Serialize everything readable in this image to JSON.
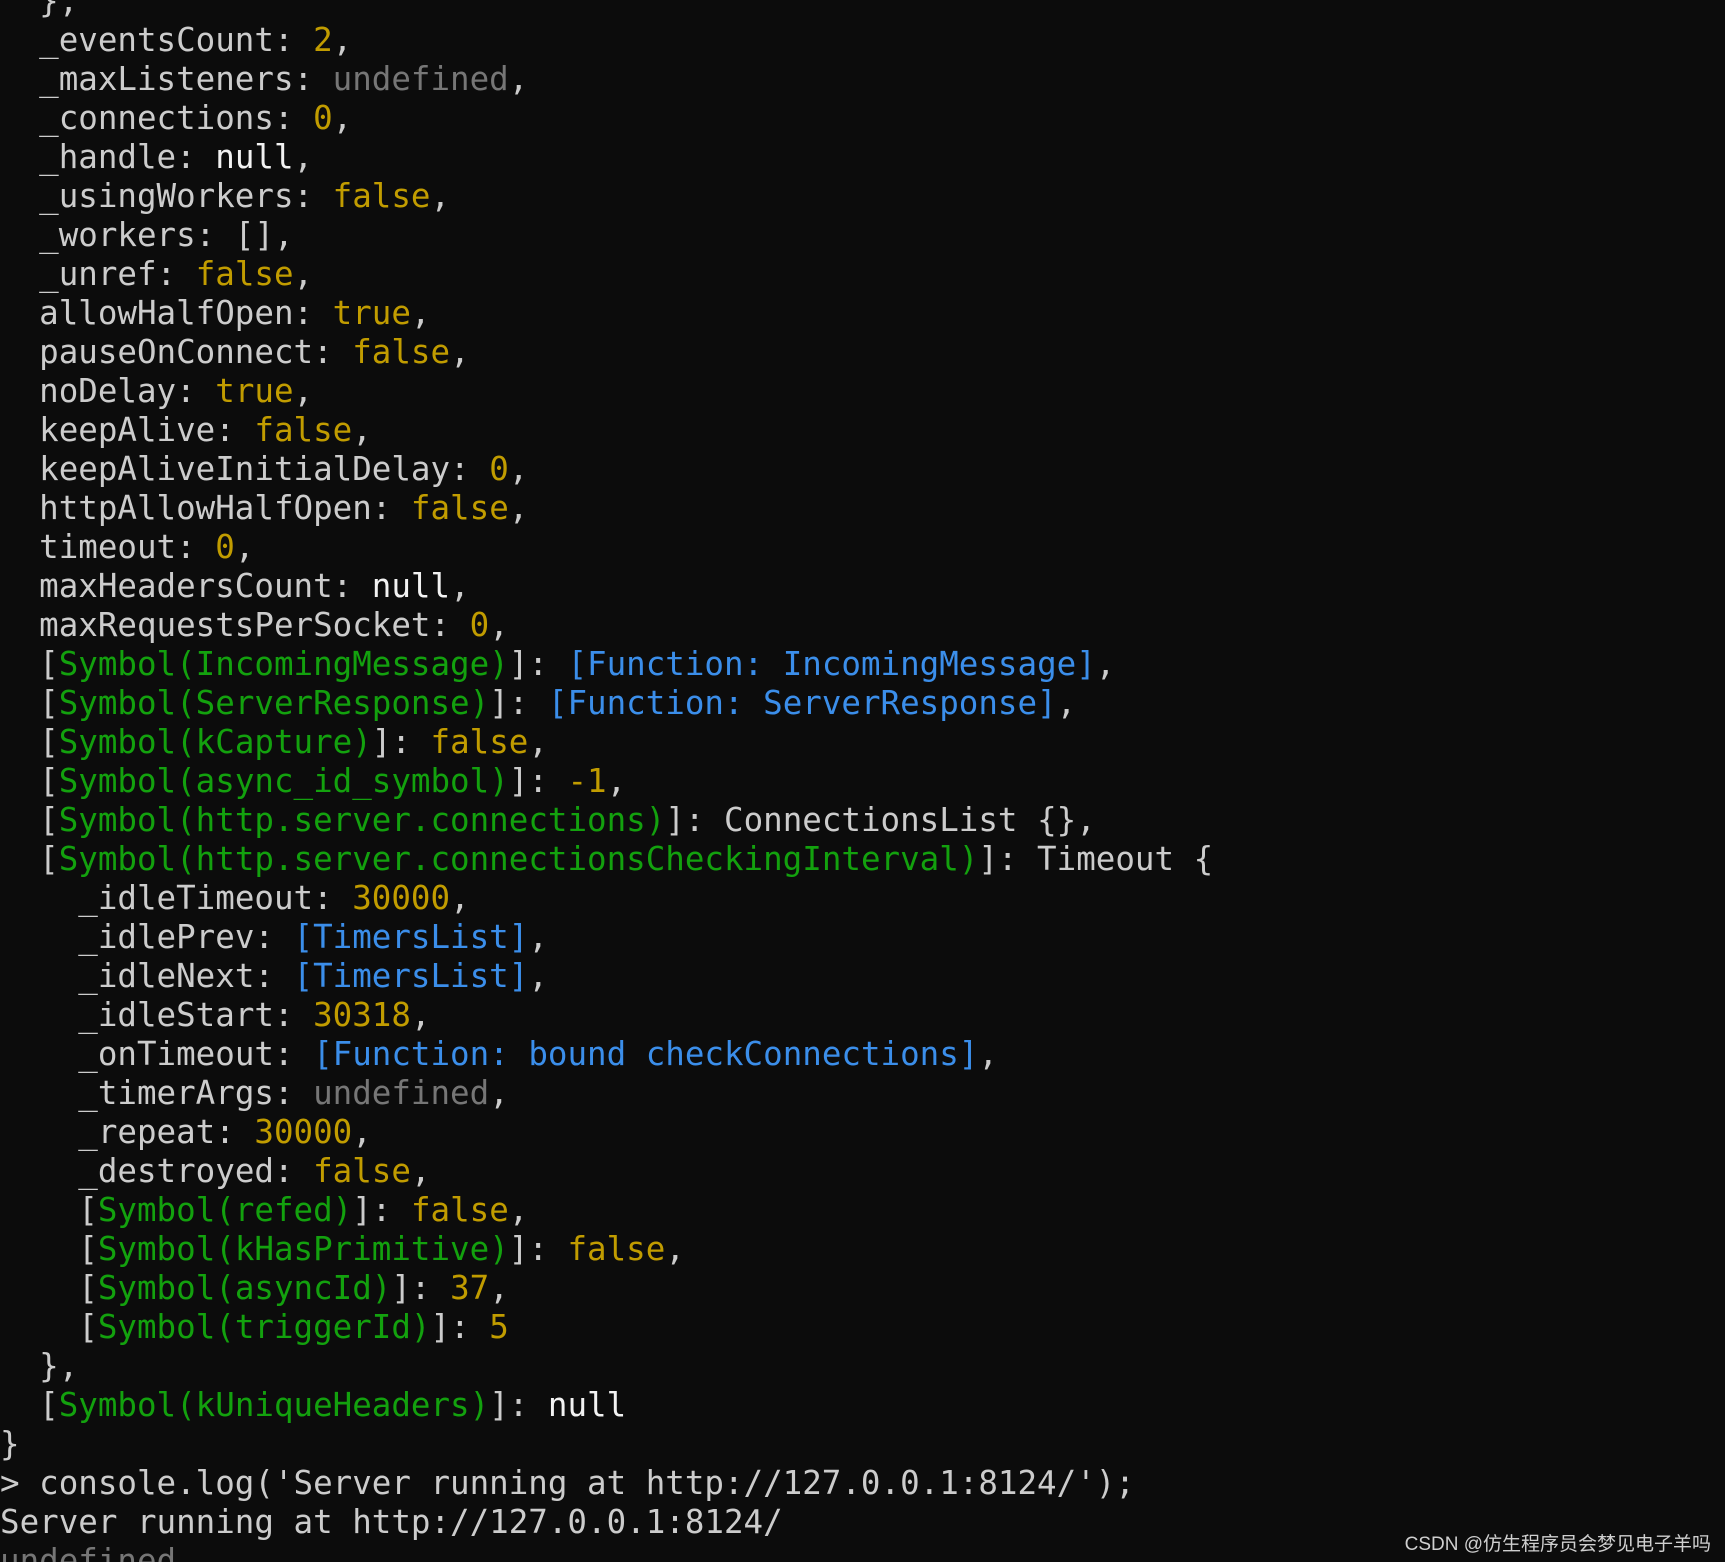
{
  "terminal": {
    "lines": [
      {
        "indent": 1,
        "parts": [
          {
            "t": "},",
            "c": "default"
          }
        ]
      },
      {
        "indent": 1,
        "parts": [
          {
            "t": "_eventsCount: ",
            "c": "default"
          },
          {
            "t": "2",
            "c": "num"
          },
          {
            "t": ",",
            "c": "default"
          }
        ]
      },
      {
        "indent": 1,
        "parts": [
          {
            "t": "_maxListeners: ",
            "c": "default"
          },
          {
            "t": "undefined",
            "c": "undef"
          },
          {
            "t": ",",
            "c": "default"
          }
        ]
      },
      {
        "indent": 1,
        "parts": [
          {
            "t": "_connections: ",
            "c": "default"
          },
          {
            "t": "0",
            "c": "num"
          },
          {
            "t": ",",
            "c": "default"
          }
        ]
      },
      {
        "indent": 1,
        "parts": [
          {
            "t": "_handle: ",
            "c": "default"
          },
          {
            "t": "null",
            "c": "bright"
          },
          {
            "t": ",",
            "c": "default"
          }
        ]
      },
      {
        "indent": 1,
        "parts": [
          {
            "t": "_usingWorkers: ",
            "c": "default"
          },
          {
            "t": "false",
            "c": "num"
          },
          {
            "t": ",",
            "c": "default"
          }
        ]
      },
      {
        "indent": 1,
        "parts": [
          {
            "t": "_workers: [],",
            "c": "default"
          }
        ]
      },
      {
        "indent": 1,
        "parts": [
          {
            "t": "_unref: ",
            "c": "default"
          },
          {
            "t": "false",
            "c": "num"
          },
          {
            "t": ",",
            "c": "default"
          }
        ]
      },
      {
        "indent": 1,
        "parts": [
          {
            "t": "allowHalfOpen: ",
            "c": "default"
          },
          {
            "t": "true",
            "c": "num"
          },
          {
            "t": ",",
            "c": "default"
          }
        ]
      },
      {
        "indent": 1,
        "parts": [
          {
            "t": "pauseOnConnect: ",
            "c": "default"
          },
          {
            "t": "false",
            "c": "num"
          },
          {
            "t": ",",
            "c": "default"
          }
        ]
      },
      {
        "indent": 1,
        "parts": [
          {
            "t": "noDelay: ",
            "c": "default"
          },
          {
            "t": "true",
            "c": "num"
          },
          {
            "t": ",",
            "c": "default"
          }
        ]
      },
      {
        "indent": 1,
        "parts": [
          {
            "t": "keepAlive: ",
            "c": "default"
          },
          {
            "t": "false",
            "c": "num"
          },
          {
            "t": ",",
            "c": "default"
          }
        ]
      },
      {
        "indent": 1,
        "parts": [
          {
            "t": "keepAliveInitialDelay: ",
            "c": "default"
          },
          {
            "t": "0",
            "c": "num"
          },
          {
            "t": ",",
            "c": "default"
          }
        ]
      },
      {
        "indent": 1,
        "parts": [
          {
            "t": "httpAllowHalfOpen: ",
            "c": "default"
          },
          {
            "t": "false",
            "c": "num"
          },
          {
            "t": ",",
            "c": "default"
          }
        ]
      },
      {
        "indent": 1,
        "parts": [
          {
            "t": "timeout: ",
            "c": "default"
          },
          {
            "t": "0",
            "c": "num"
          },
          {
            "t": ",",
            "c": "default"
          }
        ]
      },
      {
        "indent": 1,
        "parts": [
          {
            "t": "maxHeadersCount: ",
            "c": "default"
          },
          {
            "t": "null",
            "c": "bright"
          },
          {
            "t": ",",
            "c": "default"
          }
        ]
      },
      {
        "indent": 1,
        "parts": [
          {
            "t": "maxRequestsPerSocket: ",
            "c": "default"
          },
          {
            "t": "0",
            "c": "num"
          },
          {
            "t": ",",
            "c": "default"
          }
        ]
      },
      {
        "indent": 1,
        "parts": [
          {
            "t": "[",
            "c": "default"
          },
          {
            "t": "Symbol(IncomingMessage)",
            "c": "sym"
          },
          {
            "t": "]: ",
            "c": "default"
          },
          {
            "t": "[Function: IncomingMessage]",
            "c": "fn"
          },
          {
            "t": ",",
            "c": "default"
          }
        ]
      },
      {
        "indent": 1,
        "parts": [
          {
            "t": "[",
            "c": "default"
          },
          {
            "t": "Symbol(ServerResponse)",
            "c": "sym"
          },
          {
            "t": "]: ",
            "c": "default"
          },
          {
            "t": "[Function: ServerResponse]",
            "c": "fn"
          },
          {
            "t": ",",
            "c": "default"
          }
        ]
      },
      {
        "indent": 1,
        "parts": [
          {
            "t": "[",
            "c": "default"
          },
          {
            "t": "Symbol(kCapture)",
            "c": "sym"
          },
          {
            "t": "]: ",
            "c": "default"
          },
          {
            "t": "false",
            "c": "num"
          },
          {
            "t": ",",
            "c": "default"
          }
        ]
      },
      {
        "indent": 1,
        "parts": [
          {
            "t": "[",
            "c": "default"
          },
          {
            "t": "Symbol(async_id_symbol)",
            "c": "sym"
          },
          {
            "t": "]: ",
            "c": "default"
          },
          {
            "t": "-1",
            "c": "num"
          },
          {
            "t": ",",
            "c": "default"
          }
        ]
      },
      {
        "indent": 1,
        "parts": [
          {
            "t": "[",
            "c": "default"
          },
          {
            "t": "Symbol(http.server.connections)",
            "c": "sym"
          },
          {
            "t": "]: ConnectionsList {},",
            "c": "default"
          }
        ]
      },
      {
        "indent": 1,
        "parts": [
          {
            "t": "[",
            "c": "default"
          },
          {
            "t": "Symbol(http.server.connectionsCheckingInterval)",
            "c": "sym"
          },
          {
            "t": "]: Timeout {",
            "c": "default"
          }
        ]
      },
      {
        "indent": 2,
        "parts": [
          {
            "t": "_idleTimeout: ",
            "c": "default"
          },
          {
            "t": "30000",
            "c": "num"
          },
          {
            "t": ",",
            "c": "default"
          }
        ]
      },
      {
        "indent": 2,
        "parts": [
          {
            "t": "_idlePrev: ",
            "c": "default"
          },
          {
            "t": "[TimersList]",
            "c": "fn"
          },
          {
            "t": ",",
            "c": "default"
          }
        ]
      },
      {
        "indent": 2,
        "parts": [
          {
            "t": "_idleNext: ",
            "c": "default"
          },
          {
            "t": "[TimersList]",
            "c": "fn"
          },
          {
            "t": ",",
            "c": "default"
          }
        ]
      },
      {
        "indent": 2,
        "parts": [
          {
            "t": "_idleStart: ",
            "c": "default"
          },
          {
            "t": "30318",
            "c": "num"
          },
          {
            "t": ",",
            "c": "default"
          }
        ]
      },
      {
        "indent": 2,
        "parts": [
          {
            "t": "_onTimeout: ",
            "c": "default"
          },
          {
            "t": "[Function: bound checkConnections]",
            "c": "fn"
          },
          {
            "t": ",",
            "c": "default"
          }
        ]
      },
      {
        "indent": 2,
        "parts": [
          {
            "t": "_timerArgs: ",
            "c": "default"
          },
          {
            "t": "undefined",
            "c": "undef"
          },
          {
            "t": ",",
            "c": "default"
          }
        ]
      },
      {
        "indent": 2,
        "parts": [
          {
            "t": "_repeat: ",
            "c": "default"
          },
          {
            "t": "30000",
            "c": "num"
          },
          {
            "t": ",",
            "c": "default"
          }
        ]
      },
      {
        "indent": 2,
        "parts": [
          {
            "t": "_destroyed: ",
            "c": "default"
          },
          {
            "t": "false",
            "c": "num"
          },
          {
            "t": ",",
            "c": "default"
          }
        ]
      },
      {
        "indent": 2,
        "parts": [
          {
            "t": "[",
            "c": "default"
          },
          {
            "t": "Symbol(refed)",
            "c": "sym"
          },
          {
            "t": "]: ",
            "c": "default"
          },
          {
            "t": "false",
            "c": "num"
          },
          {
            "t": ",",
            "c": "default"
          }
        ]
      },
      {
        "indent": 2,
        "parts": [
          {
            "t": "[",
            "c": "default"
          },
          {
            "t": "Symbol(kHasPrimitive)",
            "c": "sym"
          },
          {
            "t": "]: ",
            "c": "default"
          },
          {
            "t": "false",
            "c": "num"
          },
          {
            "t": ",",
            "c": "default"
          }
        ]
      },
      {
        "indent": 2,
        "parts": [
          {
            "t": "[",
            "c": "default"
          },
          {
            "t": "Symbol(asyncId)",
            "c": "sym"
          },
          {
            "t": "]: ",
            "c": "default"
          },
          {
            "t": "37",
            "c": "num"
          },
          {
            "t": ",",
            "c": "default"
          }
        ]
      },
      {
        "indent": 2,
        "parts": [
          {
            "t": "[",
            "c": "default"
          },
          {
            "t": "Symbol(triggerId)",
            "c": "sym"
          },
          {
            "t": "]: ",
            "c": "default"
          },
          {
            "t": "5",
            "c": "num"
          }
        ]
      },
      {
        "indent": 1,
        "parts": [
          {
            "t": "},",
            "c": "default"
          }
        ]
      },
      {
        "indent": 1,
        "parts": [
          {
            "t": "[",
            "c": "default"
          },
          {
            "t": "Symbol(kUniqueHeaders)",
            "c": "sym"
          },
          {
            "t": "]: ",
            "c": "default"
          },
          {
            "t": "null",
            "c": "bright"
          }
        ]
      },
      {
        "indent": 0,
        "parts": [
          {
            "t": "}",
            "c": "default"
          }
        ]
      },
      {
        "indent": 0,
        "parts": [
          {
            "t": "> console.log('Server running at http://127.0.0.1:8124/');",
            "c": "default"
          }
        ]
      },
      {
        "indent": 0,
        "parts": [
          {
            "t": "Server running at http://127.0.0.1:8124/",
            "c": "default"
          }
        ]
      },
      {
        "indent": 0,
        "parts": [
          {
            "t": "undefined",
            "c": "undef"
          }
        ]
      }
    ]
  },
  "watermark": "CSDN @仿生程序员会梦见电子羊吗"
}
